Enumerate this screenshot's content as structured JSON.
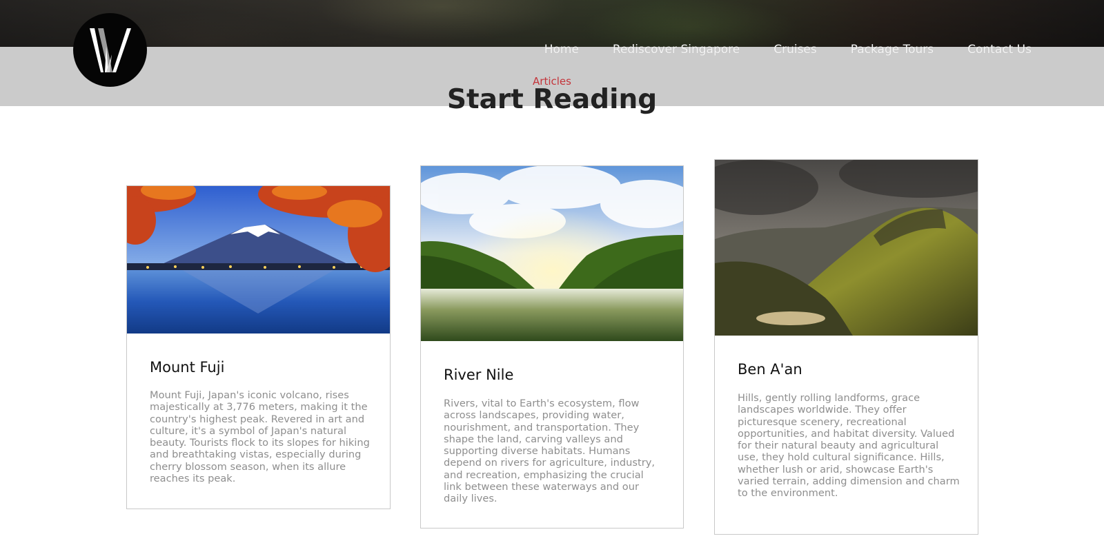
{
  "header": {
    "logo_letter": "W",
    "nav": [
      {
        "label": "Home"
      },
      {
        "label": "Rediscover Singapore"
      },
      {
        "label": "Cruises"
      },
      {
        "label": "Package Tours"
      },
      {
        "label": "Contact Us"
      }
    ]
  },
  "section": {
    "eyebrow": "Articles",
    "title": "Start Reading"
  },
  "cards": [
    {
      "title": "Mount Fuji",
      "image": "mount-fuji-photo",
      "text": "Mount Fuji, Japan's iconic volcano, rises majestically at 3,776 meters, making it the country's highest peak. Revered in art and culture, it's a symbol of Japan's natural beauty. Tourists flock to its slopes for hiking and breathtaking vistas, especially during cherry blossom season, when its allure reaches its peak."
    },
    {
      "title": "River Nile",
      "image": "river-nile-photo",
      "text": "Rivers, vital to Earth's ecosystem, flow across landscapes, providing water, nourishment, and transportation. They shape the land, carving valleys and supporting diverse habitats. Humans depend on rivers for agriculture, industry, and recreation, emphasizing the crucial link between these waterways and our daily lives."
    },
    {
      "title": "Ben A'an",
      "image": "ben-aan-photo",
      "text": "Hills, gently rolling landforms, grace landscapes worldwide. They offer picturesque scenery, recreational opportunities, and habitat diversity. Valued for their natural beauty and agricultural use, they hold cultural significance. Hills, whether lush or arid, showcase Earth's varied terrain, adding dimension and charm to the environment."
    }
  ],
  "colors": {
    "accent": "#c4343a",
    "band": "#cbcbcb",
    "title": "#222222",
    "body_text": "#8e8e8e"
  }
}
